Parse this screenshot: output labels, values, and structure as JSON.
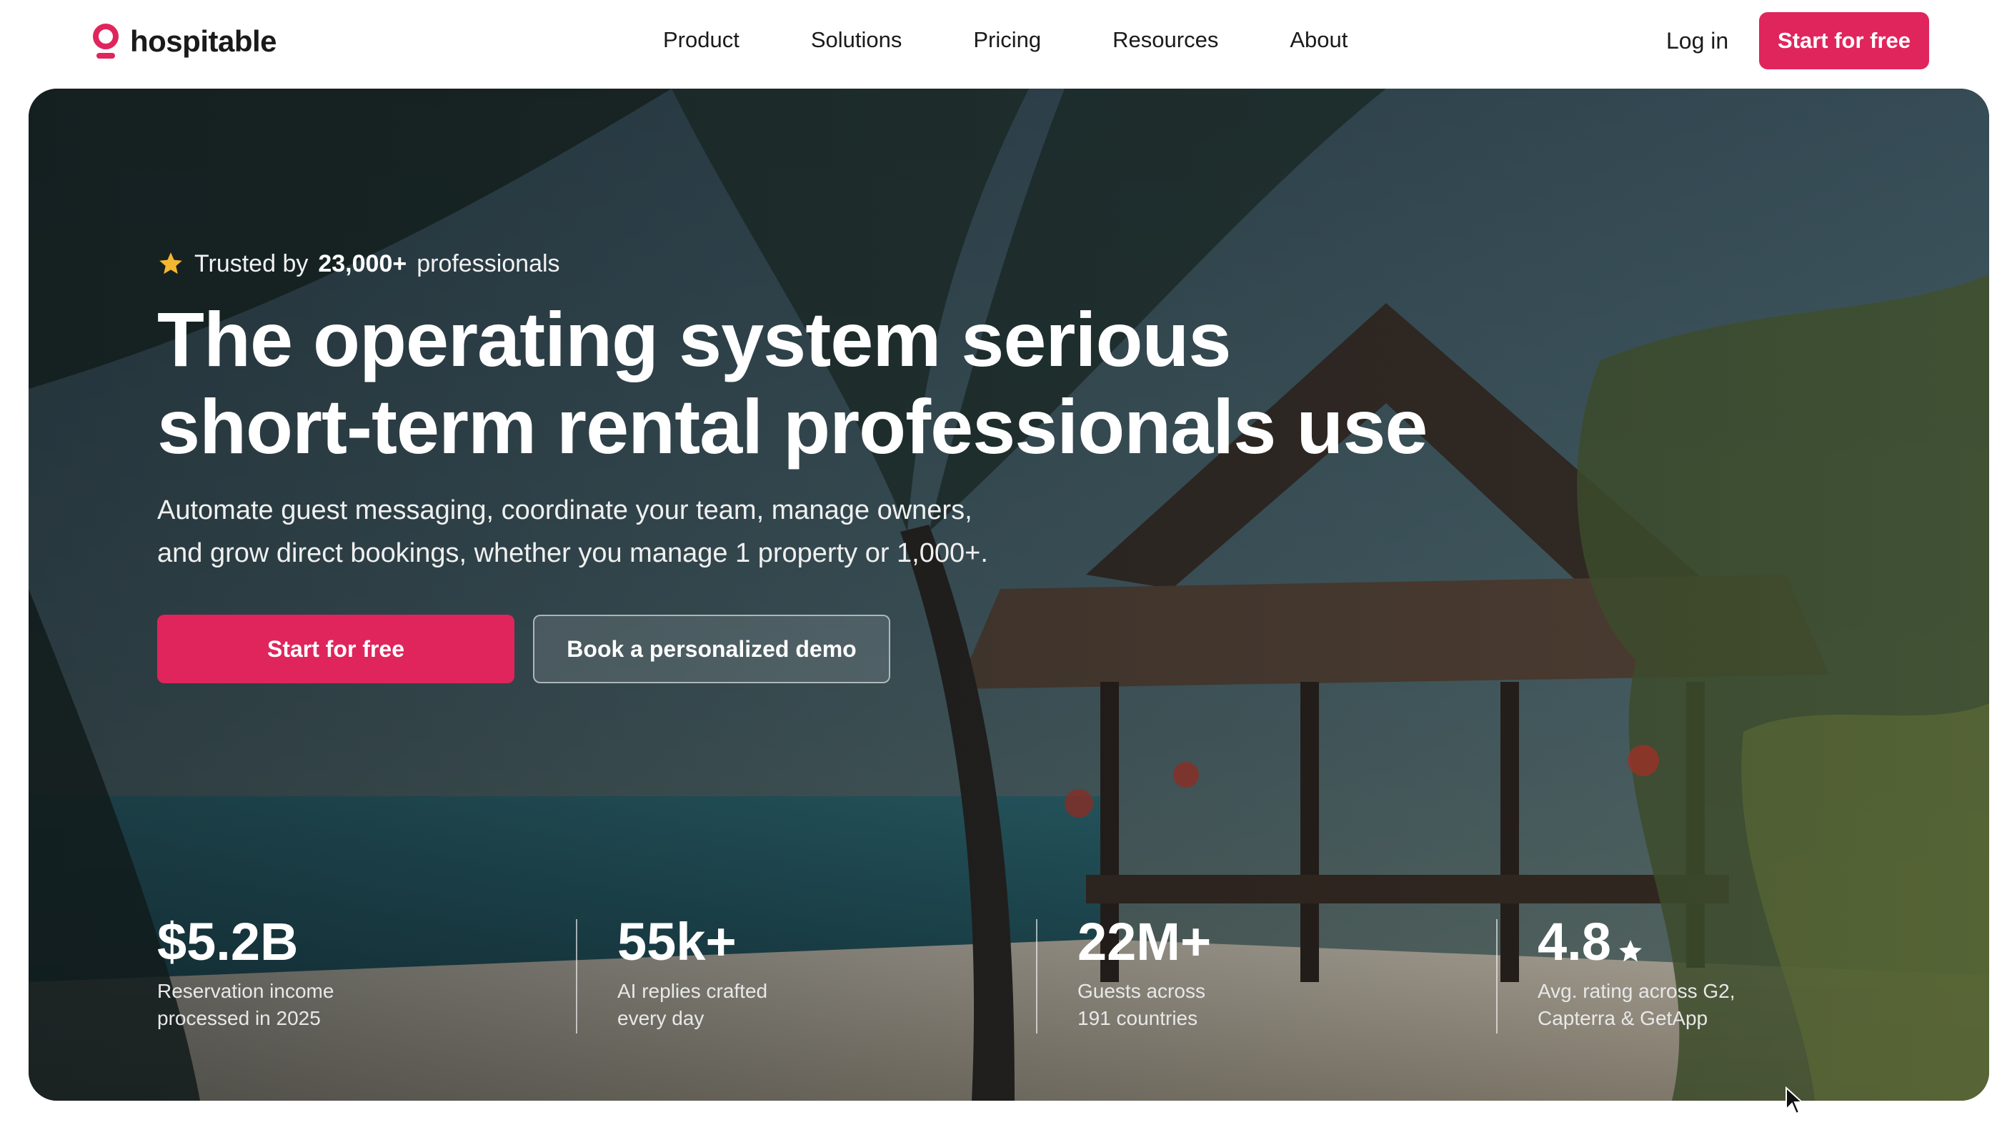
{
  "brand": {
    "name": "hospitable",
    "accent": "#e0255c"
  },
  "nav": {
    "items": [
      {
        "label": "Product"
      },
      {
        "label": "Solutions"
      },
      {
        "label": "Pricing"
      },
      {
        "label": "Resources"
      },
      {
        "label": "About"
      }
    ],
    "login": "Log in",
    "cta": "Start for free"
  },
  "hero": {
    "trusted_prefix": "Trusted by",
    "trusted_count": "23,000+",
    "trusted_suffix": "professionals",
    "headline_line1": "The operating system serious",
    "headline_line2": "short-term rental professionals use",
    "subhead_line1": "Automate guest messaging, coordinate your team, manage owners,",
    "subhead_line2": "and grow direct bookings, whether you manage 1 property or 1,000+.",
    "primary_cta": "Start for free",
    "secondary_cta": "Book a personalized demo"
  },
  "stats": [
    {
      "value": "$5.2B",
      "label_line1": "Reservation income",
      "label_line2": "processed in 2025"
    },
    {
      "value": "55k+",
      "label_line1": "AI replies crafted",
      "label_line2": "every day"
    },
    {
      "value": "22M+",
      "label_line1": "Guests across",
      "label_line2": "191 countries"
    },
    {
      "value": "4.8",
      "label_line1": "Avg. rating across G2,",
      "label_line2": "Capterra & GetApp",
      "icon": "star-icon"
    }
  ]
}
